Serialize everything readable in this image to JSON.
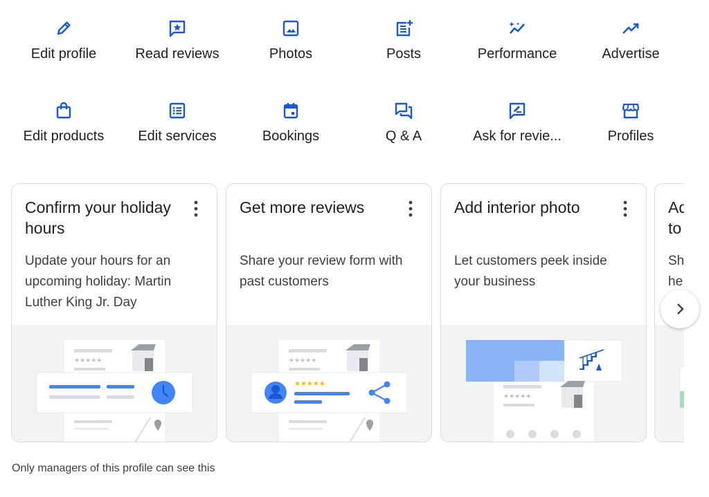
{
  "actions_row1": [
    {
      "label": "Edit profile",
      "icon": "pencil-icon"
    },
    {
      "label": "Read reviews",
      "icon": "star-review-icon"
    },
    {
      "label": "Photos",
      "icon": "photo-icon"
    },
    {
      "label": "Posts",
      "icon": "post-add-icon"
    },
    {
      "label": "Performance",
      "icon": "sparkle-trend-icon"
    },
    {
      "label": "Advertise",
      "icon": "trending-up-icon"
    }
  ],
  "actions_row2": [
    {
      "label": "Edit products",
      "icon": "shopping-bag-icon"
    },
    {
      "label": "Edit services",
      "icon": "list-icon"
    },
    {
      "label": "Bookings",
      "icon": "calendar-icon"
    },
    {
      "label": "Q & A",
      "icon": "forum-icon"
    },
    {
      "label": "Ask for revie...",
      "icon": "rate-review-icon"
    },
    {
      "label": "Profiles",
      "icon": "storefront-icon"
    }
  ],
  "cards": [
    {
      "title": "Confirm your holiday hours",
      "description": "Update your hours for an upcoming holiday: Martin Luther King Jr. Day"
    },
    {
      "title": "Get more reviews",
      "description": "Share your review form with past customers"
    },
    {
      "title": "Add interior photo",
      "description": "Let customers peek inside your business"
    },
    {
      "title": "Ad to",
      "description": "Sh he"
    }
  ],
  "footer_note": "Only managers of this profile can see this",
  "colors": {
    "accent": "#1a57d2",
    "card_border": "#dadce0",
    "illus_bg": "#f1f3f4",
    "blue_bar": "#4285f4",
    "star": "#fbbc04"
  }
}
